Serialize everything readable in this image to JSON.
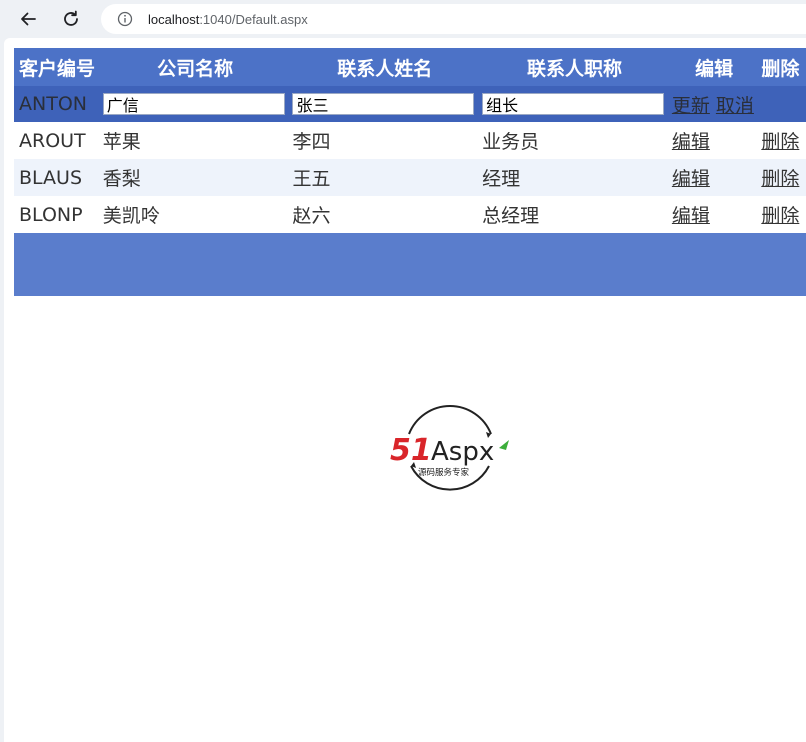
{
  "browser": {
    "url_host": "localhost",
    "url_path": ":1040/Default.aspx"
  },
  "grid": {
    "headers": [
      "客户编号",
      "公司名称",
      "联系人姓名",
      "联系人职称",
      "编辑",
      "删除"
    ],
    "edit_row": {
      "id": "ANTON",
      "company": "广信",
      "contact": "张三",
      "title": "组长",
      "update_label": "更新",
      "cancel_label": "取消"
    },
    "rows": [
      {
        "id": "AROUT",
        "company": "苹果",
        "contact": "李四",
        "title": "业务员",
        "edit": "编辑",
        "delete": "删除"
      },
      {
        "id": "BLAUS",
        "company": "香梨",
        "contact": "王五",
        "title": "经理",
        "edit": "编辑",
        "delete": "删除"
      },
      {
        "id": "BLONP",
        "company": "美凯呤",
        "contact": "赵六",
        "title": "总经理",
        "edit": "编辑",
        "delete": "删除"
      }
    ]
  },
  "logo": {
    "brand_number": "51",
    "brand_text": "Aspx",
    "tagline": "源码服务专家"
  },
  "colors": {
    "header": "#4c72c7",
    "edit_row": "#3e62b9",
    "alt_row": "#eef3fb",
    "footer": "#5a7dcc",
    "logo_red": "#d9252a",
    "logo_green": "#3cae3a"
  }
}
